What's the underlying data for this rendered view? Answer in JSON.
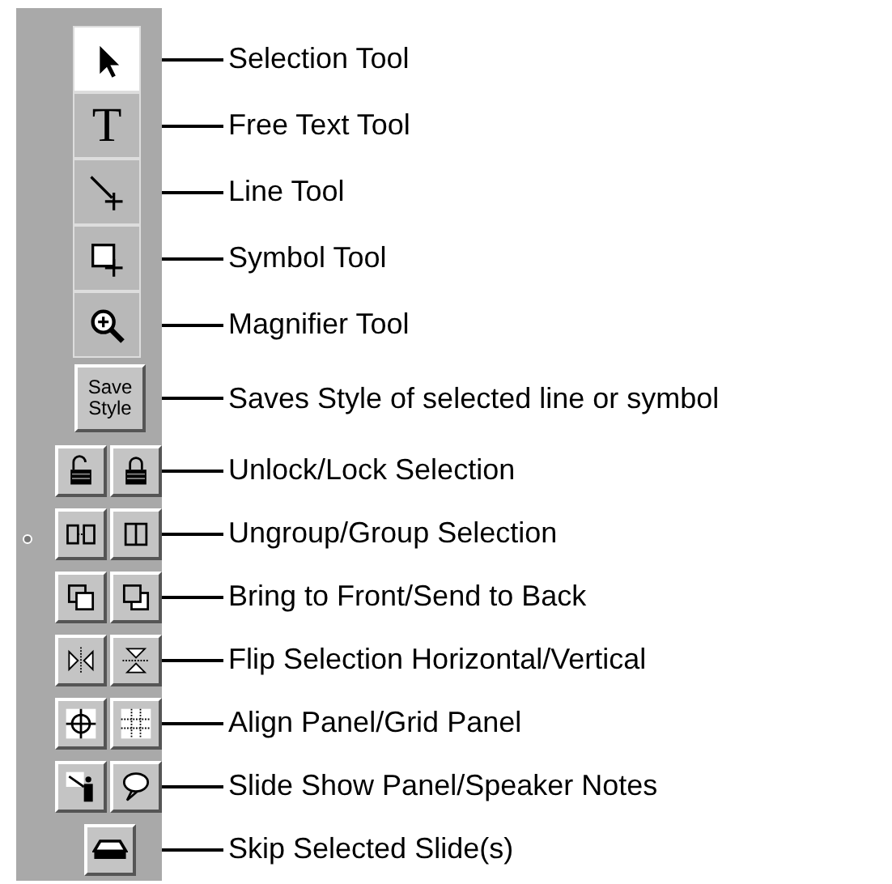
{
  "tools": [
    {
      "kind": "large",
      "selected": true,
      "label": "Selection Tool"
    },
    {
      "kind": "large",
      "selected": false,
      "label": "Free Text Tool",
      "glyph": "T"
    },
    {
      "kind": "large",
      "selected": false,
      "label": "Line Tool"
    },
    {
      "kind": "large",
      "selected": false,
      "label": "Symbol Tool"
    },
    {
      "kind": "large",
      "selected": false,
      "label": "Magnifier Tool"
    },
    {
      "kind": "text",
      "selected": false,
      "label": "Saves Style of selected line or symbol",
      "glyph": "Save Style"
    },
    {
      "kind": "pair",
      "label": "Unlock/Lock Selection"
    },
    {
      "kind": "pair",
      "label": "Ungroup/Group Selection",
      "radio": true
    },
    {
      "kind": "pair",
      "label": "Bring to Front/Send to Back"
    },
    {
      "kind": "pair",
      "label": "Flip Selection Horizontal/Vertical"
    },
    {
      "kind": "pair",
      "label": "Align Panel/Grid Panel"
    },
    {
      "kind": "pair",
      "label": "Slide Show Panel/Speaker Notes"
    },
    {
      "kind": "single",
      "label": "Skip Selected Slide(s)"
    }
  ]
}
